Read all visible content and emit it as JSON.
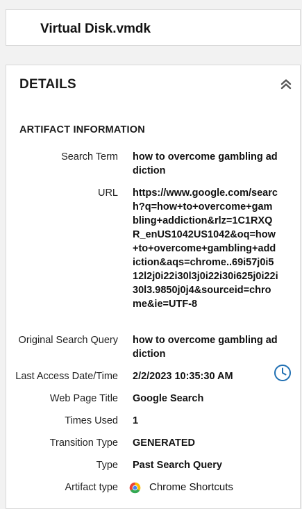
{
  "header": {
    "title": "Virtual Disk.vmdk"
  },
  "details": {
    "title": "DETAILS",
    "collapse_icon": "double-chevron-up-icon",
    "section_title": "ARTIFACT INFORMATION",
    "fields": {
      "search_term": {
        "label": "Search Term",
        "value": "how to overcome gambling addiction"
      },
      "url": {
        "label": "URL",
        "value": "https://www.google.com/search?q=how+to+overcome+gambling+addiction&rlz=1C1RXQR_enUS1042US1042&oq=how+to+overcome+gambling+addiction&aqs=chrome..69i57j0i512l2j0i22i30l3j0i22i30i625j0i22i30l3.9850j0j4&sourceid=chrome&ie=UTF-8"
      },
      "original_query": {
        "label": "Original Search Query",
        "value": "how to overcome gambling addiction"
      },
      "last_access": {
        "label": "Last Access Date/Time",
        "value": "2/2/2023 10:35:30 AM",
        "icon": "clock-icon"
      },
      "page_title": {
        "label": "Web Page Title",
        "value": "Google Search"
      },
      "times_used": {
        "label": "Times Used",
        "value": "1"
      },
      "transition_type": {
        "label": "Transition Type",
        "value": "GENERATED"
      },
      "type": {
        "label": "Type",
        "value": "Past Search Query"
      },
      "artifact_type": {
        "label": "Artifact type",
        "value": "Chrome Shortcuts",
        "icon": "chrome-icon"
      }
    }
  },
  "colors": {
    "accent": "#1f6fb2",
    "card_border": "#d9d9d9",
    "background": "#f2f2f2"
  }
}
